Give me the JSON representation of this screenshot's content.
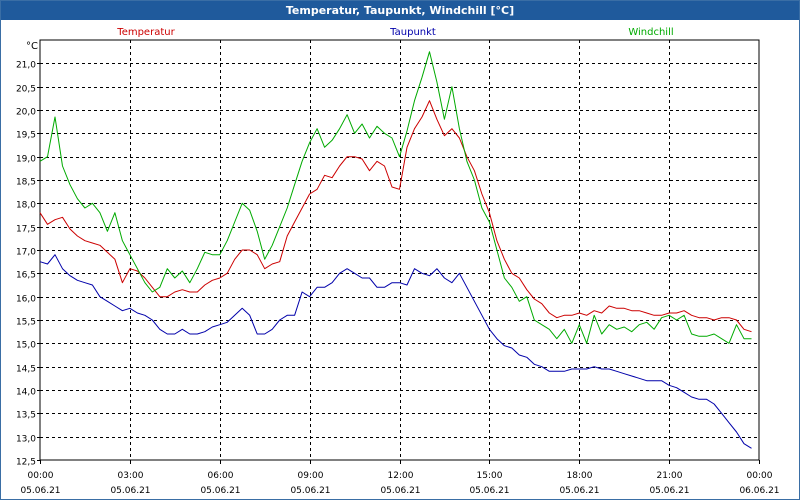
{
  "window": {
    "title": "Temperatur, Taupunkt, Windchill [°C]"
  },
  "chart_data": {
    "type": "line",
    "title": "Temperatur, Taupunkt, Windchill [°C]",
    "ylabel": "°C",
    "xlabel": "",
    "ylim": [
      12.5,
      21.5
    ],
    "xlim": [
      0,
      24
    ],
    "grid": true,
    "legend_placement": "top",
    "yticks": [
      "12,5",
      "13,0",
      "13,5",
      "14,0",
      "14,5",
      "15,0",
      "15,5",
      "16,0",
      "16,5",
      "17,0",
      "17,5",
      "18,0",
      "18,5",
      "19,0",
      "19,5",
      "20,0",
      "20,5",
      "21,0"
    ],
    "xticks": [
      {
        "time": "00:00",
        "date": "05.06.21"
      },
      {
        "time": "03:00",
        "date": "05.06.21"
      },
      {
        "time": "06:00",
        "date": "05.06.21"
      },
      {
        "time": "09:00",
        "date": "05.06.21"
      },
      {
        "time": "12:00",
        "date": "05.06.21"
      },
      {
        "time": "15:00",
        "date": "05.06.21"
      },
      {
        "time": "18:00",
        "date": "05.06.21"
      },
      {
        "time": "21:00",
        "date": "05.06.21"
      },
      {
        "time": "00:00",
        "date": "06.06.21"
      }
    ],
    "series": [
      {
        "name": "Temperatur",
        "color": "#cc0000",
        "x": [
          0,
          0.25,
          0.5,
          0.75,
          1,
          1.25,
          1.5,
          1.75,
          2,
          2.25,
          2.5,
          2.75,
          3,
          3.25,
          3.5,
          3.75,
          4,
          4.25,
          4.5,
          4.75,
          5,
          5.25,
          5.5,
          5.75,
          6,
          6.25,
          6.5,
          6.75,
          7,
          7.25,
          7.5,
          7.75,
          8,
          8.25,
          8.5,
          8.75,
          9,
          9.25,
          9.5,
          9.75,
          10,
          10.25,
          10.5,
          10.75,
          11,
          11.25,
          11.5,
          11.75,
          12,
          12.25,
          12.5,
          12.75,
          13,
          13.25,
          13.5,
          13.75,
          14,
          14.25,
          14.5,
          14.75,
          15,
          15.25,
          15.5,
          15.75,
          16,
          16.25,
          16.5,
          16.75,
          17,
          17.25,
          17.5,
          17.75,
          18,
          18.25,
          18.5,
          18.75,
          19,
          19.25,
          19.5,
          19.75,
          20,
          20.25,
          20.5,
          20.75,
          21,
          21.25,
          21.5,
          21.75,
          22,
          22.25,
          22.5,
          22.75,
          23,
          23.25,
          23.5,
          23.75
        ],
        "values": [
          17.8,
          17.55,
          17.65,
          17.7,
          17.45,
          17.3,
          17.2,
          17.15,
          17.1,
          16.95,
          16.8,
          16.3,
          16.6,
          16.55,
          16.4,
          16.2,
          16.0,
          16.0,
          16.1,
          16.15,
          16.1,
          16.1,
          16.25,
          16.35,
          16.4,
          16.5,
          16.8,
          17.0,
          17.0,
          16.9,
          16.6,
          16.7,
          16.75,
          17.3,
          17.6,
          17.9,
          18.2,
          18.3,
          18.6,
          18.55,
          18.8,
          19.0,
          19.0,
          18.95,
          18.7,
          18.9,
          18.8,
          18.35,
          18.3,
          19.2,
          19.6,
          19.85,
          20.2,
          19.8,
          19.45,
          19.6,
          19.4,
          19.0,
          18.7,
          18.2,
          17.8,
          17.2,
          16.8,
          16.5,
          16.4,
          16.15,
          15.95,
          15.85,
          15.65,
          15.55,
          15.6,
          15.6,
          15.65,
          15.6,
          15.7,
          15.65,
          15.8,
          15.75,
          15.75,
          15.7,
          15.7,
          15.65,
          15.6,
          15.6,
          15.65,
          15.65,
          15.7,
          15.6,
          15.55,
          15.55,
          15.5,
          15.55,
          15.55,
          15.5,
          15.3,
          15.25
        ]
      },
      {
        "name": "Taupunkt",
        "color": "#0000aa",
        "x": [
          0,
          0.25,
          0.5,
          0.75,
          1,
          1.25,
          1.5,
          1.75,
          2,
          2.25,
          2.5,
          2.75,
          3,
          3.25,
          3.5,
          3.75,
          4,
          4.25,
          4.5,
          4.75,
          5,
          5.25,
          5.5,
          5.75,
          6,
          6.25,
          6.5,
          6.75,
          7,
          7.25,
          7.5,
          7.75,
          8,
          8.25,
          8.5,
          8.75,
          9,
          9.25,
          9.5,
          9.75,
          10,
          10.25,
          10.5,
          10.75,
          11,
          11.25,
          11.5,
          11.75,
          12,
          12.25,
          12.5,
          12.75,
          13,
          13.25,
          13.5,
          13.75,
          14,
          14.25,
          14.5,
          14.75,
          15,
          15.25,
          15.5,
          15.75,
          16,
          16.25,
          16.5,
          16.75,
          17,
          17.25,
          17.5,
          17.75,
          18,
          18.25,
          18.5,
          18.75,
          19,
          19.25,
          19.5,
          19.75,
          20,
          20.25,
          20.5,
          20.75,
          21,
          21.25,
          21.5,
          21.75,
          22,
          22.25,
          22.5,
          22.75,
          23,
          23.25,
          23.5,
          23.75
        ],
        "values": [
          16.75,
          16.7,
          16.9,
          16.6,
          16.45,
          16.35,
          16.3,
          16.25,
          16.0,
          15.9,
          15.8,
          15.7,
          15.75,
          15.65,
          15.6,
          15.5,
          15.3,
          15.2,
          15.2,
          15.3,
          15.2,
          15.2,
          15.25,
          15.35,
          15.4,
          15.45,
          15.6,
          15.75,
          15.6,
          15.2,
          15.2,
          15.3,
          15.5,
          15.6,
          15.6,
          16.1,
          16.0,
          16.2,
          16.2,
          16.3,
          16.5,
          16.6,
          16.5,
          16.4,
          16.4,
          16.2,
          16.2,
          16.3,
          16.3,
          16.25,
          16.6,
          16.5,
          16.45,
          16.6,
          16.4,
          16.3,
          16.5,
          16.2,
          15.9,
          15.6,
          15.3,
          15.1,
          14.95,
          14.9,
          14.75,
          14.7,
          14.55,
          14.5,
          14.4,
          14.4,
          14.4,
          14.45,
          14.45,
          14.45,
          14.5,
          14.45,
          14.45,
          14.4,
          14.35,
          14.3,
          14.25,
          14.2,
          14.2,
          14.2,
          14.1,
          14.05,
          13.95,
          13.85,
          13.8,
          13.8,
          13.7,
          13.5,
          13.3,
          13.1,
          12.85,
          12.75
        ]
      },
      {
        "name": "Windchill",
        "color": "#00aa00",
        "x": [
          0,
          0.25,
          0.5,
          0.75,
          1,
          1.25,
          1.5,
          1.75,
          2,
          2.25,
          2.5,
          2.75,
          3,
          3.25,
          3.5,
          3.75,
          4,
          4.25,
          4.5,
          4.75,
          5,
          5.25,
          5.5,
          5.75,
          6,
          6.25,
          6.5,
          6.75,
          7,
          7.25,
          7.5,
          7.75,
          8,
          8.25,
          8.5,
          8.75,
          9,
          9.25,
          9.5,
          9.75,
          10,
          10.25,
          10.5,
          10.75,
          11,
          11.25,
          11.5,
          11.75,
          12,
          12.25,
          12.5,
          12.75,
          13,
          13.25,
          13.5,
          13.75,
          14,
          14.25,
          14.5,
          14.75,
          15,
          15.25,
          15.5,
          15.75,
          16,
          16.25,
          16.5,
          16.75,
          17,
          17.25,
          17.5,
          17.75,
          18,
          18.25,
          18.5,
          18.75,
          19,
          19.25,
          19.5,
          19.75,
          20,
          20.25,
          20.5,
          20.75,
          21,
          21.25,
          21.5,
          21.75,
          22,
          22.25,
          22.5,
          22.75,
          23,
          23.25,
          23.5,
          23.75
        ],
        "values": [
          18.9,
          19.0,
          19.85,
          18.8,
          18.4,
          18.1,
          17.9,
          18.0,
          17.8,
          17.4,
          17.8,
          17.2,
          16.9,
          16.6,
          16.3,
          16.1,
          16.2,
          16.6,
          16.4,
          16.55,
          16.3,
          16.6,
          16.95,
          16.9,
          16.9,
          17.2,
          17.6,
          18.0,
          17.85,
          17.4,
          16.8,
          17.1,
          17.5,
          17.9,
          18.4,
          18.9,
          19.3,
          19.6,
          19.2,
          19.35,
          19.6,
          19.9,
          19.5,
          19.7,
          19.4,
          19.65,
          19.5,
          19.4,
          19.0,
          19.55,
          20.2,
          20.7,
          21.25,
          20.6,
          19.8,
          20.5,
          19.6,
          18.9,
          18.5,
          17.9,
          17.6,
          17.0,
          16.4,
          16.2,
          15.9,
          16.0,
          15.5,
          15.4,
          15.3,
          15.1,
          15.3,
          15.0,
          15.4,
          15.0,
          15.6,
          15.2,
          15.4,
          15.3,
          15.35,
          15.25,
          15.4,
          15.45,
          15.3,
          15.55,
          15.6,
          15.5,
          15.6,
          15.2,
          15.15,
          15.15,
          15.2,
          15.1,
          15.0,
          15.4,
          15.1,
          15.1
        ]
      }
    ]
  }
}
